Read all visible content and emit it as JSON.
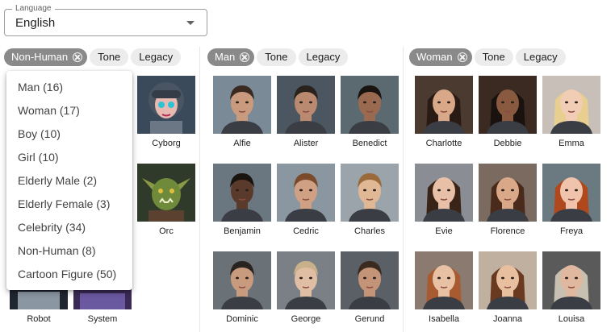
{
  "language": {
    "label": "Language",
    "value": "English"
  },
  "columns": [
    {
      "chips": {
        "selected": "Non-Human",
        "tone": "Tone",
        "legacy": "Legacy"
      },
      "voices": [
        "Cyborg",
        "Orc",
        "Robot",
        "System"
      ]
    },
    {
      "chips": {
        "selected": "Man",
        "tone": "Tone",
        "legacy": "Legacy"
      },
      "voices": [
        "Alfie",
        "Alister",
        "Benedict",
        "Benjamin",
        "Cedric",
        "Charles",
        "Dominic",
        "George",
        "Gerund"
      ]
    },
    {
      "chips": {
        "selected": "Woman",
        "tone": "Tone",
        "legacy": "Legacy"
      },
      "voices": [
        "Charlotte",
        "Debbie",
        "Emma",
        "Evie",
        "Florence",
        "Freya",
        "Isabella",
        "Joanna",
        "Louisa"
      ]
    }
  ],
  "menu": {
    "items": [
      "Man (16)",
      "Woman (17)",
      "Boy (10)",
      "Girl (10)",
      "Elderly Male (2)",
      "Elderly Female (3)",
      "Celebrity (34)",
      "Non-Human (8)",
      "Cartoon Figure (50)"
    ]
  },
  "icons": {
    "select_caret": "chevron-down-icon",
    "chip_clear": "close-circle-icon"
  },
  "colors": {
    "chip_selected": "#8a8a8a",
    "chip": "#ececec",
    "border": "#9e9e9e"
  }
}
